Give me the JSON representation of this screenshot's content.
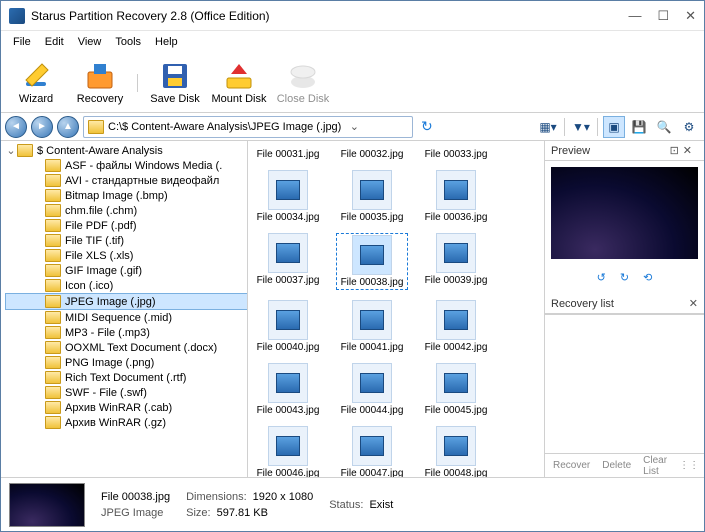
{
  "window": {
    "title": "Starus Partition Recovery 2.8 (Office Edition)"
  },
  "menu": [
    "File",
    "Edit",
    "View",
    "Tools",
    "Help"
  ],
  "toolbar": [
    {
      "label": "Wizard"
    },
    {
      "label": "Recovery"
    },
    {
      "label": "Save Disk"
    },
    {
      "label": "Mount Disk"
    },
    {
      "label": "Close Disk"
    }
  ],
  "address": "C:\\$ Content-Aware Analysis\\JPEG Image (.jpg)",
  "tree_root": "$ Content-Aware Analysis",
  "tree_items": [
    "ASF - файлы Windows Media (.",
    "AVI - стандартные видеофайл",
    "Bitmap Image (.bmp)",
    "chm.file (.chm)",
    "File PDF (.pdf)",
    "File TIF (.tif)",
    "File XLS (.xls)",
    "GIF Image (.gif)",
    "Icon (.ico)",
    "JPEG Image (.jpg)",
    "MIDI Sequence (.mid)",
    "MP3 - File (.mp3)",
    "OOXML Text Document (.docx)",
    "PNG Image (.png)",
    "Rich Text Document (.rtf)",
    "SWF - File (.swf)",
    "Архив WinRAR (.cab)",
    "Архив WinRAR (.gz)"
  ],
  "tree_selected": 9,
  "file_rows": [
    [
      "File 00031.jpg",
      "File 00032.jpg",
      "File 00033.jpg"
    ],
    [
      "File 00034.jpg",
      "File 00035.jpg",
      "File 00036.jpg"
    ],
    [
      "File 00037.jpg",
      "File 00038.jpg",
      "File 00039.jpg"
    ],
    [
      "File 00040.jpg",
      "File 00041.jpg",
      "File 00042.jpg"
    ],
    [
      "File 00043.jpg",
      "File 00044.jpg",
      "File 00045.jpg"
    ],
    [
      "File 00046.jpg",
      "File 00047.jpg",
      "File 00048.jpg"
    ]
  ],
  "file_selected": "File 00038.jpg",
  "rpanel": {
    "preview": "Preview",
    "recovery": "Recovery list",
    "recover": "Recover",
    "delete": "Delete",
    "clear": "Clear List"
  },
  "status": {
    "name": "File 00038.jpg",
    "type": "JPEG Image",
    "dim_label": "Dimensions:",
    "dim": "1920 x 1080",
    "size_label": "Size:",
    "size": "597.81 KB",
    "status_label": "Status:",
    "status": "Exist"
  }
}
